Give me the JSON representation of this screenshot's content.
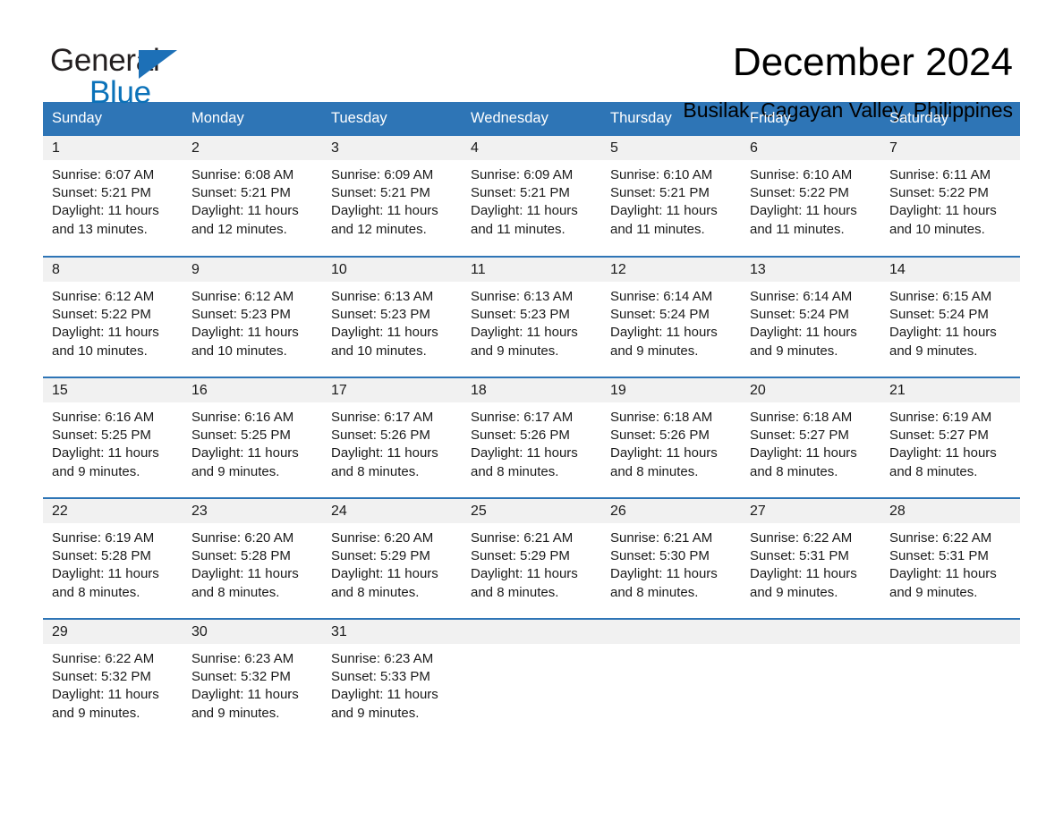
{
  "brand": {
    "line1": "General",
    "line2": "Blue",
    "triangle_color": "#1d70b7",
    "text_color": "#231f20",
    "accent_color": "#0b72b9"
  },
  "header": {
    "title": "December 2024",
    "subtitle": "Busilak, Cagayan Valley, Philippines"
  },
  "theme": {
    "header_blue": "#2e75b6",
    "daynum_band": "#f1f1f1",
    "text": "#1a1a1a"
  },
  "weekday_headers": [
    "Sunday",
    "Monday",
    "Tuesday",
    "Wednesday",
    "Thursday",
    "Friday",
    "Saturday"
  ],
  "labels": {
    "sunrise_prefix": "Sunrise:",
    "sunset_prefix": "Sunset:",
    "daylight_prefix": "Daylight:"
  },
  "weeks": [
    [
      {
        "day": "1",
        "sunrise": "Sunrise: 6:07 AM",
        "sunset": "Sunset: 5:21 PM",
        "daylight_l1": "Daylight: 11 hours",
        "daylight_l2": "and 13 minutes."
      },
      {
        "day": "2",
        "sunrise": "Sunrise: 6:08 AM",
        "sunset": "Sunset: 5:21 PM",
        "daylight_l1": "Daylight: 11 hours",
        "daylight_l2": "and 12 minutes."
      },
      {
        "day": "3",
        "sunrise": "Sunrise: 6:09 AM",
        "sunset": "Sunset: 5:21 PM",
        "daylight_l1": "Daylight: 11 hours",
        "daylight_l2": "and 12 minutes."
      },
      {
        "day": "4",
        "sunrise": "Sunrise: 6:09 AM",
        "sunset": "Sunset: 5:21 PM",
        "daylight_l1": "Daylight: 11 hours",
        "daylight_l2": "and 11 minutes."
      },
      {
        "day": "5",
        "sunrise": "Sunrise: 6:10 AM",
        "sunset": "Sunset: 5:21 PM",
        "daylight_l1": "Daylight: 11 hours",
        "daylight_l2": "and 11 minutes."
      },
      {
        "day": "6",
        "sunrise": "Sunrise: 6:10 AM",
        "sunset": "Sunset: 5:22 PM",
        "daylight_l1": "Daylight: 11 hours",
        "daylight_l2": "and 11 minutes."
      },
      {
        "day": "7",
        "sunrise": "Sunrise: 6:11 AM",
        "sunset": "Sunset: 5:22 PM",
        "daylight_l1": "Daylight: 11 hours",
        "daylight_l2": "and 10 minutes."
      }
    ],
    [
      {
        "day": "8",
        "sunrise": "Sunrise: 6:12 AM",
        "sunset": "Sunset: 5:22 PM",
        "daylight_l1": "Daylight: 11 hours",
        "daylight_l2": "and 10 minutes."
      },
      {
        "day": "9",
        "sunrise": "Sunrise: 6:12 AM",
        "sunset": "Sunset: 5:23 PM",
        "daylight_l1": "Daylight: 11 hours",
        "daylight_l2": "and 10 minutes."
      },
      {
        "day": "10",
        "sunrise": "Sunrise: 6:13 AM",
        "sunset": "Sunset: 5:23 PM",
        "daylight_l1": "Daylight: 11 hours",
        "daylight_l2": "and 10 minutes."
      },
      {
        "day": "11",
        "sunrise": "Sunrise: 6:13 AM",
        "sunset": "Sunset: 5:23 PM",
        "daylight_l1": "Daylight: 11 hours",
        "daylight_l2": "and 9 minutes."
      },
      {
        "day": "12",
        "sunrise": "Sunrise: 6:14 AM",
        "sunset": "Sunset: 5:24 PM",
        "daylight_l1": "Daylight: 11 hours",
        "daylight_l2": "and 9 minutes."
      },
      {
        "day": "13",
        "sunrise": "Sunrise: 6:14 AM",
        "sunset": "Sunset: 5:24 PM",
        "daylight_l1": "Daylight: 11 hours",
        "daylight_l2": "and 9 minutes."
      },
      {
        "day": "14",
        "sunrise": "Sunrise: 6:15 AM",
        "sunset": "Sunset: 5:24 PM",
        "daylight_l1": "Daylight: 11 hours",
        "daylight_l2": "and 9 minutes."
      }
    ],
    [
      {
        "day": "15",
        "sunrise": "Sunrise: 6:16 AM",
        "sunset": "Sunset: 5:25 PM",
        "daylight_l1": "Daylight: 11 hours",
        "daylight_l2": "and 9 minutes."
      },
      {
        "day": "16",
        "sunrise": "Sunrise: 6:16 AM",
        "sunset": "Sunset: 5:25 PM",
        "daylight_l1": "Daylight: 11 hours",
        "daylight_l2": "and 9 minutes."
      },
      {
        "day": "17",
        "sunrise": "Sunrise: 6:17 AM",
        "sunset": "Sunset: 5:26 PM",
        "daylight_l1": "Daylight: 11 hours",
        "daylight_l2": "and 8 minutes."
      },
      {
        "day": "18",
        "sunrise": "Sunrise: 6:17 AM",
        "sunset": "Sunset: 5:26 PM",
        "daylight_l1": "Daylight: 11 hours",
        "daylight_l2": "and 8 minutes."
      },
      {
        "day": "19",
        "sunrise": "Sunrise: 6:18 AM",
        "sunset": "Sunset: 5:26 PM",
        "daylight_l1": "Daylight: 11 hours",
        "daylight_l2": "and 8 minutes."
      },
      {
        "day": "20",
        "sunrise": "Sunrise: 6:18 AM",
        "sunset": "Sunset: 5:27 PM",
        "daylight_l1": "Daylight: 11 hours",
        "daylight_l2": "and 8 minutes."
      },
      {
        "day": "21",
        "sunrise": "Sunrise: 6:19 AM",
        "sunset": "Sunset: 5:27 PM",
        "daylight_l1": "Daylight: 11 hours",
        "daylight_l2": "and 8 minutes."
      }
    ],
    [
      {
        "day": "22",
        "sunrise": "Sunrise: 6:19 AM",
        "sunset": "Sunset: 5:28 PM",
        "daylight_l1": "Daylight: 11 hours",
        "daylight_l2": "and 8 minutes."
      },
      {
        "day": "23",
        "sunrise": "Sunrise: 6:20 AM",
        "sunset": "Sunset: 5:28 PM",
        "daylight_l1": "Daylight: 11 hours",
        "daylight_l2": "and 8 minutes."
      },
      {
        "day": "24",
        "sunrise": "Sunrise: 6:20 AM",
        "sunset": "Sunset: 5:29 PM",
        "daylight_l1": "Daylight: 11 hours",
        "daylight_l2": "and 8 minutes."
      },
      {
        "day": "25",
        "sunrise": "Sunrise: 6:21 AM",
        "sunset": "Sunset: 5:29 PM",
        "daylight_l1": "Daylight: 11 hours",
        "daylight_l2": "and 8 minutes."
      },
      {
        "day": "26",
        "sunrise": "Sunrise: 6:21 AM",
        "sunset": "Sunset: 5:30 PM",
        "daylight_l1": "Daylight: 11 hours",
        "daylight_l2": "and 8 minutes."
      },
      {
        "day": "27",
        "sunrise": "Sunrise: 6:22 AM",
        "sunset": "Sunset: 5:31 PM",
        "daylight_l1": "Daylight: 11 hours",
        "daylight_l2": "and 9 minutes."
      },
      {
        "day": "28",
        "sunrise": "Sunrise: 6:22 AM",
        "sunset": "Sunset: 5:31 PM",
        "daylight_l1": "Daylight: 11 hours",
        "daylight_l2": "and 9 minutes."
      }
    ],
    [
      {
        "day": "29",
        "sunrise": "Sunrise: 6:22 AM",
        "sunset": "Sunset: 5:32 PM",
        "daylight_l1": "Daylight: 11 hours",
        "daylight_l2": "and 9 minutes."
      },
      {
        "day": "30",
        "sunrise": "Sunrise: 6:23 AM",
        "sunset": "Sunset: 5:32 PM",
        "daylight_l1": "Daylight: 11 hours",
        "daylight_l2": "and 9 minutes."
      },
      {
        "day": "31",
        "sunrise": "Sunrise: 6:23 AM",
        "sunset": "Sunset: 5:33 PM",
        "daylight_l1": "Daylight: 11 hours",
        "daylight_l2": "and 9 minutes."
      },
      {
        "day": "",
        "sunrise": "",
        "sunset": "",
        "daylight_l1": "",
        "daylight_l2": ""
      },
      {
        "day": "",
        "sunrise": "",
        "sunset": "",
        "daylight_l1": "",
        "daylight_l2": ""
      },
      {
        "day": "",
        "sunrise": "",
        "sunset": "",
        "daylight_l1": "",
        "daylight_l2": ""
      },
      {
        "day": "",
        "sunrise": "",
        "sunset": "",
        "daylight_l1": "",
        "daylight_l2": ""
      }
    ]
  ]
}
